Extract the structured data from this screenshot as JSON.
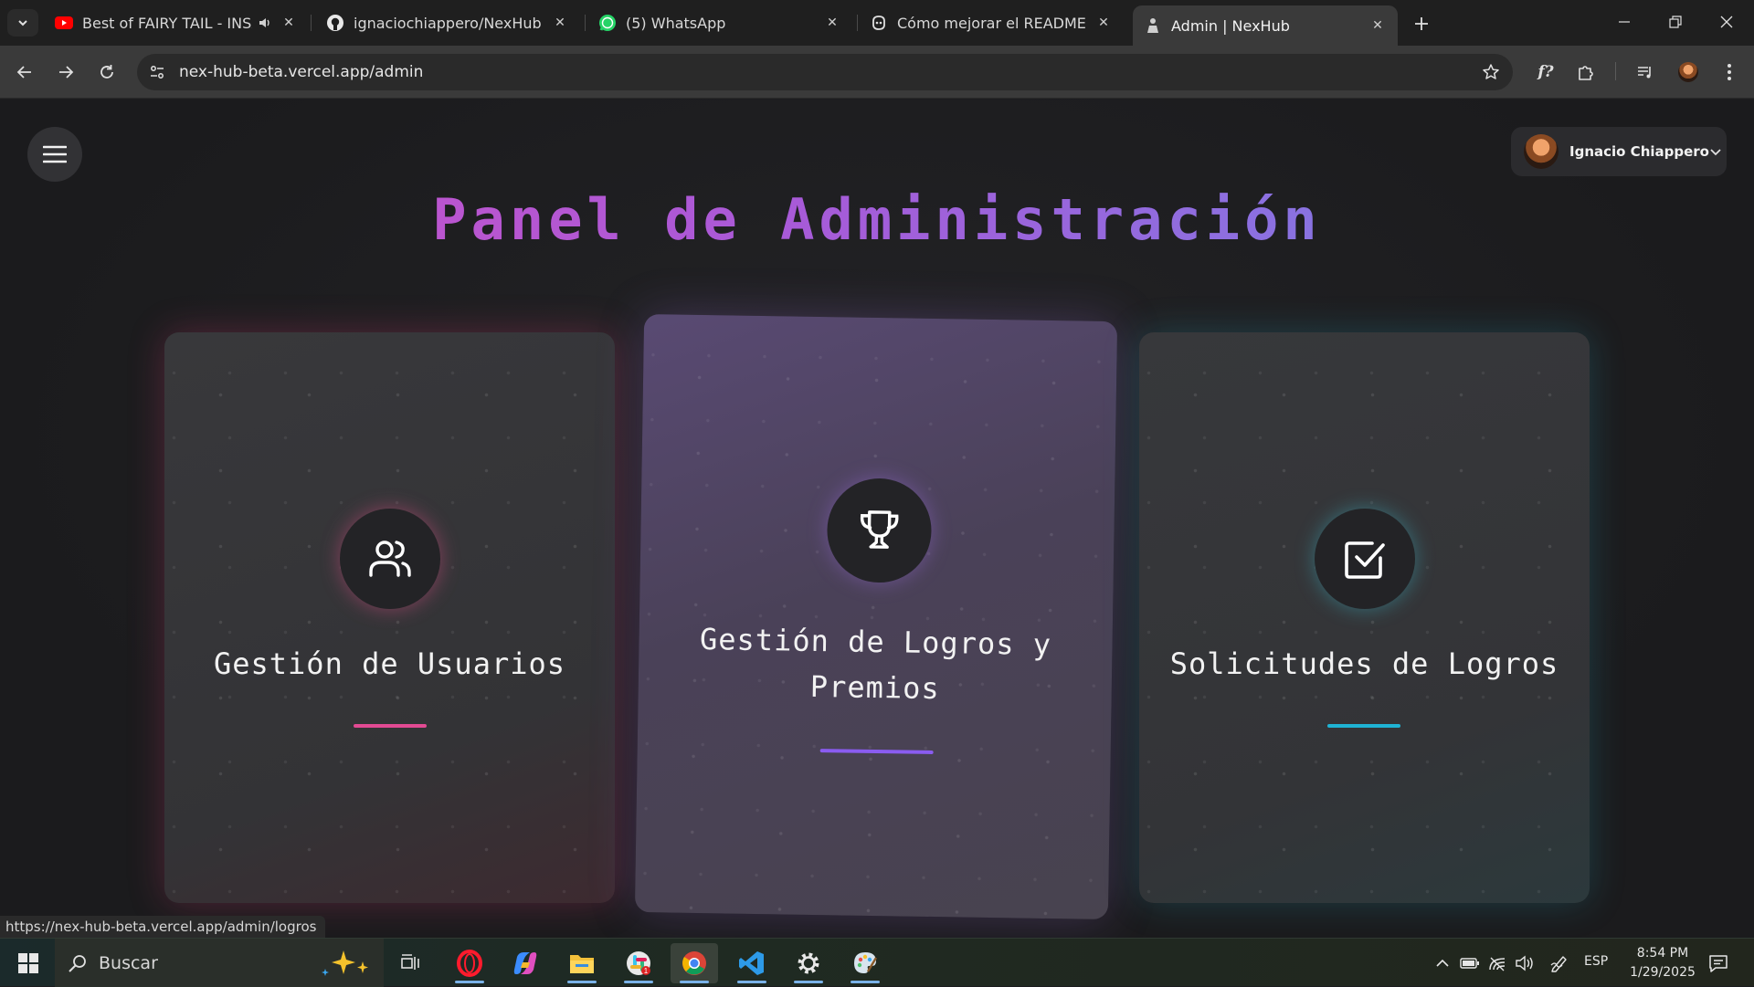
{
  "browser": {
    "tabs": [
      {
        "title": "Best of FAIRY TAIL - INSANE",
        "icon": "youtube-icon",
        "audio": true,
        "active": false
      },
      {
        "title": "ignaciochiappero/NexHub",
        "icon": "github-icon",
        "active": false
      },
      {
        "title": "(5) WhatsApp",
        "icon": "whatsapp-icon",
        "active": false
      },
      {
        "title": "Cómo mejorar el README de un",
        "icon": "copilot-icon",
        "active": false
      },
      {
        "title": "Admin | NexHub",
        "icon": "nexhub-icon",
        "active": true
      }
    ],
    "url": "nex-hub-beta.vercel.app/admin",
    "status_url": "https://nex-hub-beta.vercel.app/admin/logros"
  },
  "page": {
    "user_name": "Ignacio Chiappero",
    "title": "Panel de Administración",
    "cards": [
      {
        "title": "Gestión de Usuarios",
        "icon": "users-icon",
        "accent": "#e24a93"
      },
      {
        "title": "Gestión de Logros y Premios",
        "icon": "trophy-icon",
        "accent": "#8a5cf0"
      },
      {
        "title": "Solicitudes de Logros",
        "icon": "check-square-icon",
        "accent": "#1fb3d4"
      }
    ]
  },
  "taskbar": {
    "search_label": "Buscar",
    "language": "ESP",
    "time": "8:54 PM",
    "date": "1/29/2025"
  }
}
